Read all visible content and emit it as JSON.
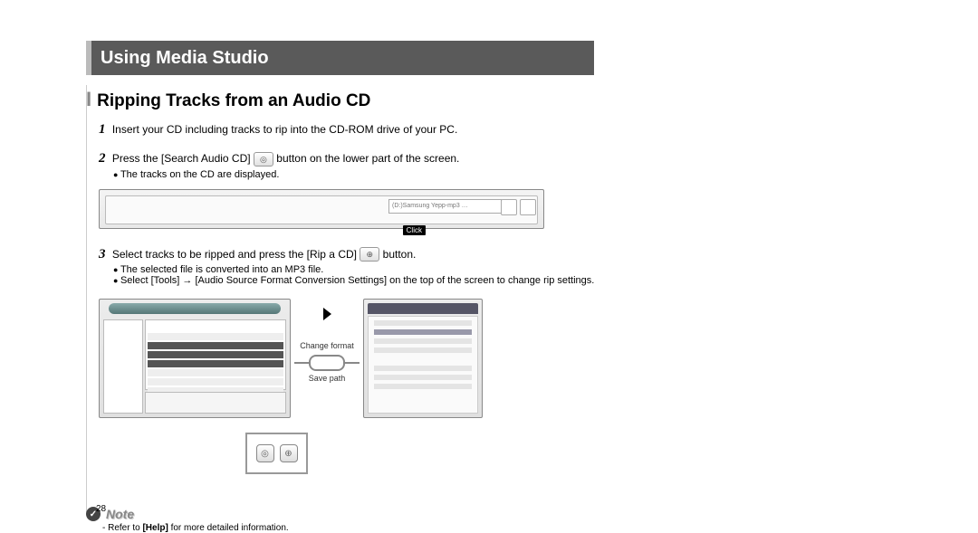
{
  "header": {
    "title": "Using Media Studio"
  },
  "section": {
    "bar": "I",
    "title": "Ripping Tracks from an Audio CD"
  },
  "steps": {
    "s1": {
      "num": "1",
      "text": "Insert your CD including tracks to rip into the CD-ROM drive of your PC."
    },
    "s2": {
      "num": "2",
      "pre": "Press the [Search Audio CD] ",
      "post": " button on the lower part of the screen.",
      "bullet": "The tracks on the CD are displayed."
    },
    "s3": {
      "num": "3",
      "pre": "Select tracks to be ripped and press the [Rip a CD] ",
      "post": " button.",
      "b1": "The selected file is converted into an MP3 file.",
      "b2": "Select [Tools] → [Audio Source Format Conversion Settings] on the top of the screen to change rip settings."
    }
  },
  "figure": {
    "click": "Click",
    "change": "Change format",
    "save": "Save path",
    "drop": "(D:)Samsung Yepp-mp3 …"
  },
  "note": {
    "badge": "✓",
    "word": "Note",
    "dash": "- Refer to ",
    "bold": "[Help]",
    "rest": " for more detailed information."
  },
  "page_number": "28"
}
